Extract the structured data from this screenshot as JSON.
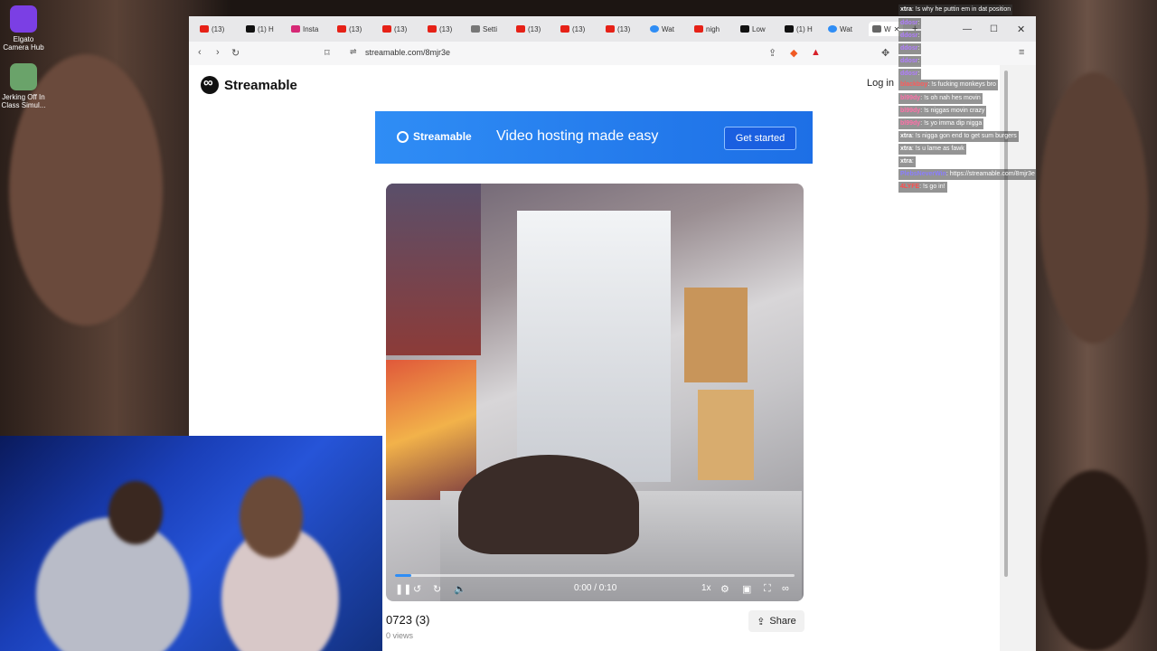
{
  "desktop": {
    "icons": [
      {
        "label": "Elgato Camera Hub",
        "color": "#7b3fe4"
      },
      {
        "label": "Jerking Off In Class Simul...",
        "color": "#6aa36a"
      }
    ]
  },
  "browser": {
    "tabs": [
      {
        "label": "(13)",
        "icon": "youtube-icon",
        "color": "#e62117"
      },
      {
        "label": "(1) H",
        "icon": "x-icon",
        "color": "#111111"
      },
      {
        "label": "Insta",
        "icon": "instagram-icon",
        "color": "#d62976"
      },
      {
        "label": "(13)",
        "icon": "youtube-icon",
        "color": "#e62117"
      },
      {
        "label": "(13)",
        "icon": "youtube-icon",
        "color": "#e62117"
      },
      {
        "label": "(13)",
        "icon": "youtube-icon",
        "color": "#e62117"
      },
      {
        "label": "Setti",
        "icon": "gear-icon",
        "color": "#555555"
      },
      {
        "label": "(13)",
        "icon": "youtube-icon",
        "color": "#e62117"
      },
      {
        "label": "(13)",
        "icon": "youtube-icon",
        "color": "#e62117"
      },
      {
        "label": "(13)",
        "icon": "youtube-icon",
        "color": "#e62117"
      },
      {
        "label": "Wat",
        "icon": "streamable-icon",
        "color": "#2f8df5"
      },
      {
        "label": "nigh",
        "icon": "youtube-icon",
        "color": "#e62117"
      },
      {
        "label": "Low",
        "icon": "tiktok-icon",
        "color": "#111111"
      },
      {
        "label": "(1) H",
        "icon": "x-icon",
        "color": "#111111"
      },
      {
        "label": "Wat",
        "icon": "streamable-icon",
        "color": "#2f8df5"
      },
      {
        "label": "W",
        "icon": "speaker-icon",
        "color": "#555555"
      }
    ],
    "url": "streamable.com/8mjr3e"
  },
  "page": {
    "logo_text": "Streamable",
    "login_label": "Log in",
    "banner": {
      "brand": "Streamable",
      "tagline": "Video hosting made easy",
      "cta_label": "Get started"
    },
    "video": {
      "time": "0:00 / 0:10",
      "speed": "1x",
      "progress": 0.04
    },
    "title": "0723 (3)",
    "views": "0 views",
    "share_label": "Share"
  },
  "chat": [
    {
      "user": "xtra",
      "text": ": !s why he puttin em in dat position",
      "color": "#ffffff"
    },
    {
      "user": "ddosr",
      "text": ":",
      "color": "#b07cff"
    },
    {
      "user": "ddosr",
      "text": ":",
      "color": "#b07cff"
    },
    {
      "user": "ddosr",
      "text": ":",
      "color": "#b07cff"
    },
    {
      "user": "ddosr",
      "text": ":",
      "color": "#b07cff"
    },
    {
      "user": "ddosr",
      "text": ":",
      "color": "#b07cff"
    },
    {
      "user": "blackboy",
      "text": ": !s fucking monkeys bro",
      "color": "#ff5a5a"
    },
    {
      "user": "bl99dy",
      "text": ": !s oh nah hes movin",
      "color": "#ff6fa8"
    },
    {
      "user": "bl99dy",
      "text": ": !s niggas movin crazy",
      "color": "#ff6fa8"
    },
    {
      "user": "bl99dy",
      "text": ": !s yo imma dip nigga",
      "color": "#ff6fa8"
    },
    {
      "user": "xtra",
      "text": ": !s nigga gon end to get sum burgers",
      "color": "#ffffff"
    },
    {
      "user": "xtra",
      "text": ": !s u lame as fawk",
      "color": "#ffffff"
    },
    {
      "user": "xtra",
      "text": ":",
      "color": "#ffffff"
    },
    {
      "user": "PlebsNeverWin",
      "text": ": https://streamable.com/8mjr3e",
      "color": "#8a7dff"
    },
    {
      "user": "4LYFE",
      "text": ": !s go in!",
      "color": "#ff4d4d"
    }
  ]
}
